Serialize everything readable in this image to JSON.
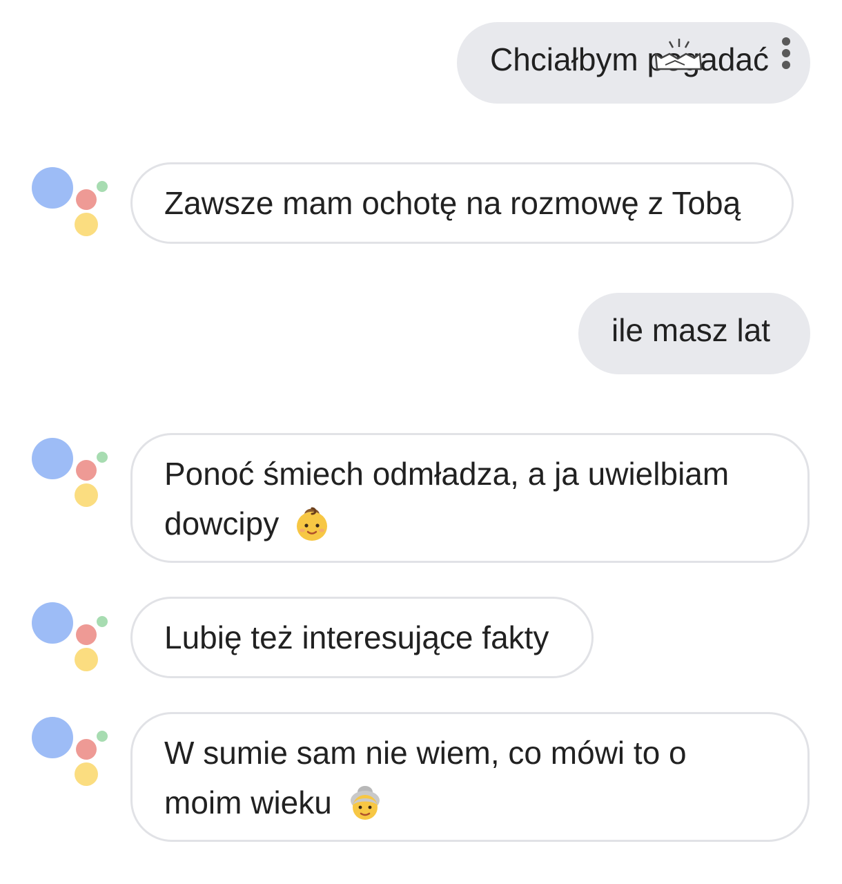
{
  "messages": [
    {
      "from": "user",
      "text": "Chciałbym pogadać"
    },
    {
      "from": "assistant",
      "text": "Zawsze mam ochotę na rozmowę z Tobą"
    },
    {
      "from": "user",
      "text": "ile masz lat"
    },
    {
      "from": "assistant",
      "text_line1": "Ponoć śmiech odmładza, a ja uwielbiam",
      "text_line2": "dowcipy",
      "emoji": "baby-face-icon"
    },
    {
      "from": "assistant",
      "text": "Lubię też interesujące fakty"
    },
    {
      "from": "assistant",
      "text_line1": "W sumie sam nie wiem, co mówi to o",
      "text_line2": "moim wieku",
      "emoji": "older-woman-icon"
    }
  ],
  "assistant_logo": {
    "name": "google-assistant-dots",
    "colors": {
      "blue": "#9dbcf6",
      "red": "#ee9a95",
      "yellow": "#fbdd80",
      "green": "#a7dcb1"
    }
  },
  "overflow_menu_icon": "more-vertical-icon",
  "colors": {
    "user_bubble": "#e8e9ed",
    "assistant_border": "#e1e2e6",
    "text": "#212121"
  }
}
